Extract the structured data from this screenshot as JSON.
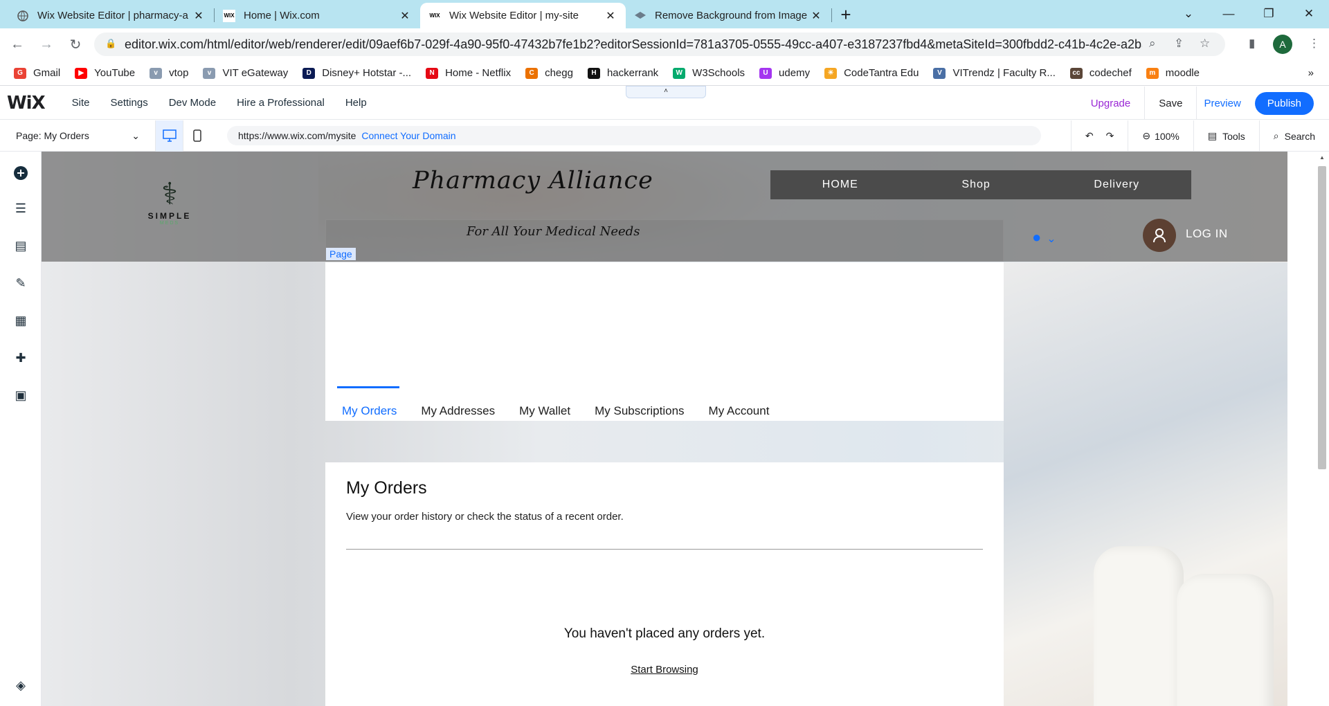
{
  "browser": {
    "tabs": [
      {
        "title": "Wix Website Editor | pharmacy-a",
        "icon": "globe-icon",
        "active": false
      },
      {
        "title": "Home | Wix.com",
        "icon": "wix-icon",
        "active": false
      },
      {
        "title": "Wix Website Editor | my-site",
        "icon": "wix-icon",
        "active": true
      },
      {
        "title": "Remove Background from Image",
        "icon": "removebg-icon",
        "active": false
      }
    ],
    "url": "editor.wix.com/html/editor/web/renderer/edit/09aef6b7-029f-4a90-95f0-47432b7fe1b2?editorSessionId=781a3705-0555-49cc-a407-e3187237fbd4&metaSiteId=300fbdd2-c41b-4c2e-a2ba-...",
    "profile_initial": "A",
    "bookmarks": [
      {
        "label": "Gmail",
        "color": "#ea4335",
        "glyph": "G"
      },
      {
        "label": "YouTube",
        "color": "#ff0000",
        "glyph": "▶"
      },
      {
        "label": "vtop",
        "color": "#8a9bb0",
        "glyph": "v"
      },
      {
        "label": "VIT eGateway",
        "color": "#8a9bb0",
        "glyph": "v"
      },
      {
        "label": "Disney+ Hotstar -...",
        "color": "#0b1b54",
        "glyph": "D"
      },
      {
        "label": "Home - Netflix",
        "color": "#e50914",
        "glyph": "N"
      },
      {
        "label": "chegg",
        "color": "#eb7100",
        "glyph": "C"
      },
      {
        "label": "hackerrank",
        "color": "#111111",
        "glyph": "H"
      },
      {
        "label": "W3Schools",
        "color": "#04aa6d",
        "glyph": "W"
      },
      {
        "label": "udemy",
        "color": "#a435f0",
        "glyph": "U"
      },
      {
        "label": "CodeTantra Edu",
        "color": "#f5a623",
        "glyph": "☀"
      },
      {
        "label": "VITrendz | Faculty R...",
        "color": "#4a6fa5",
        "glyph": "V"
      },
      {
        "label": "codechef",
        "color": "#5b4638",
        "glyph": "cc"
      },
      {
        "label": "moodle",
        "color": "#f98012",
        "glyph": "m"
      }
    ],
    "bookmarks_more": "»"
  },
  "wix": {
    "logo": "WiX",
    "menu": [
      "Site",
      "Settings",
      "Dev Mode",
      "Hire a Professional",
      "Help"
    ],
    "upgrade": "Upgrade",
    "save": "Save",
    "preview": "Preview",
    "publish": "Publish",
    "page_selector": "Page: My Orders",
    "site_url": "https://www.wix.com/mysite",
    "connect_domain": "Connect Your Domain",
    "zoom": "100%",
    "tools": "Tools",
    "search": "Search"
  },
  "site": {
    "logo_name": "SIMPLE",
    "logo_sub": "MEDS",
    "title": "Pharmacy Alliance",
    "tagline": "For All Your Medical Needs",
    "nav": [
      "HOME",
      "Shop",
      "Delivery"
    ],
    "page_tag": "Page",
    "login": "LOG IN",
    "account_tabs": [
      "My Orders",
      "My Addresses",
      "My Wallet",
      "My Subscriptions",
      "My Account"
    ],
    "orders_title": "My Orders",
    "orders_subtitle": "View your order history or check the status of a recent order.",
    "empty_message": "You haven't placed any orders yet.",
    "start_browsing": "Start Browsing"
  }
}
